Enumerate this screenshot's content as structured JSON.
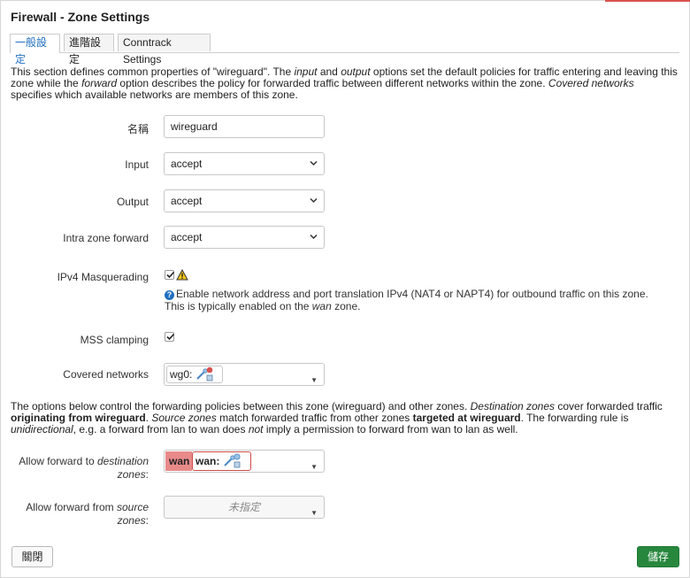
{
  "window": {
    "title": "Firewall - Zone Settings"
  },
  "tabs": [
    {
      "label": "一般設定"
    },
    {
      "label": "進階設定"
    },
    {
      "label": "Conntrack Settings"
    }
  ],
  "intro": {
    "p1": "This section defines common properties of \"wireguard\". The ",
    "input_word": "input",
    "p2": " and ",
    "output_word": "output",
    "p3": " options set the default policies for traffic entering and leaving this zone while the ",
    "forward_word": "forward",
    "p4": " option describes the policy for forwarded traffic between different networks within the zone. ",
    "covered_word": "Covered networks",
    "p5": " specifies which available networks are members of this zone."
  },
  "form": {
    "name_label": "名稱",
    "name_value": "wireguard",
    "input_label": "Input",
    "input_value": "accept",
    "output_label": "Output",
    "output_value": "accept",
    "intra_label": "Intra zone forward",
    "intra_value": "accept",
    "masq_label": "IPv4 Masquerading",
    "masq_help_1": "Enable network address and port translation IPv4 (NAT4 or NAPT4) for outbound traffic on this zone. This is typically enabled on the ",
    "masq_help_wan": "wan",
    "masq_help_2": " zone.",
    "mss_label": "MSS clamping",
    "covered_label": "Covered networks",
    "covered_chip": "wg0:"
  },
  "forwarding": {
    "p1": "The options below control the forwarding policies between this zone (wireguard) and other zones. ",
    "dest_word": "Destination zones",
    "p2": " cover forwarded traffic ",
    "orig_bold": "originating from wireguard",
    "p3": ". ",
    "src_word": "Source zones",
    "p4": " match forwarded traffic from other zones ",
    "target_bold": "targeted at wireguard",
    "p5": ". The forwarding rule is ",
    "uni_word": "unidirectional",
    "p6": ", e.g. a forward from lan to wan does ",
    "not_word": "not",
    "p7": " imply a permission to forward from wan to lan as well.",
    "dest_label_1": "Allow forward to ",
    "dest_label_it": "destination",
    "dest_label_2": "zones",
    "dest_label_colon": ":",
    "dest_zone": "wan",
    "dest_chip": "wan:",
    "src_label_1": "Allow forward from ",
    "src_label_it": "source",
    "src_label_2": "zones",
    "src_label_colon": ":",
    "src_placeholder": "未指定"
  },
  "footer": {
    "close_label": "關閉",
    "save_label": "儲存"
  },
  "colors": {
    "save": "#27873d",
    "zone_wan": "#e88a8a",
    "tab_active": "#1f6fbf"
  },
  "icons": [
    "chevron-down-icon",
    "checkmark-icon",
    "warning-icon",
    "help-icon",
    "tunnel-interface-icon"
  ]
}
